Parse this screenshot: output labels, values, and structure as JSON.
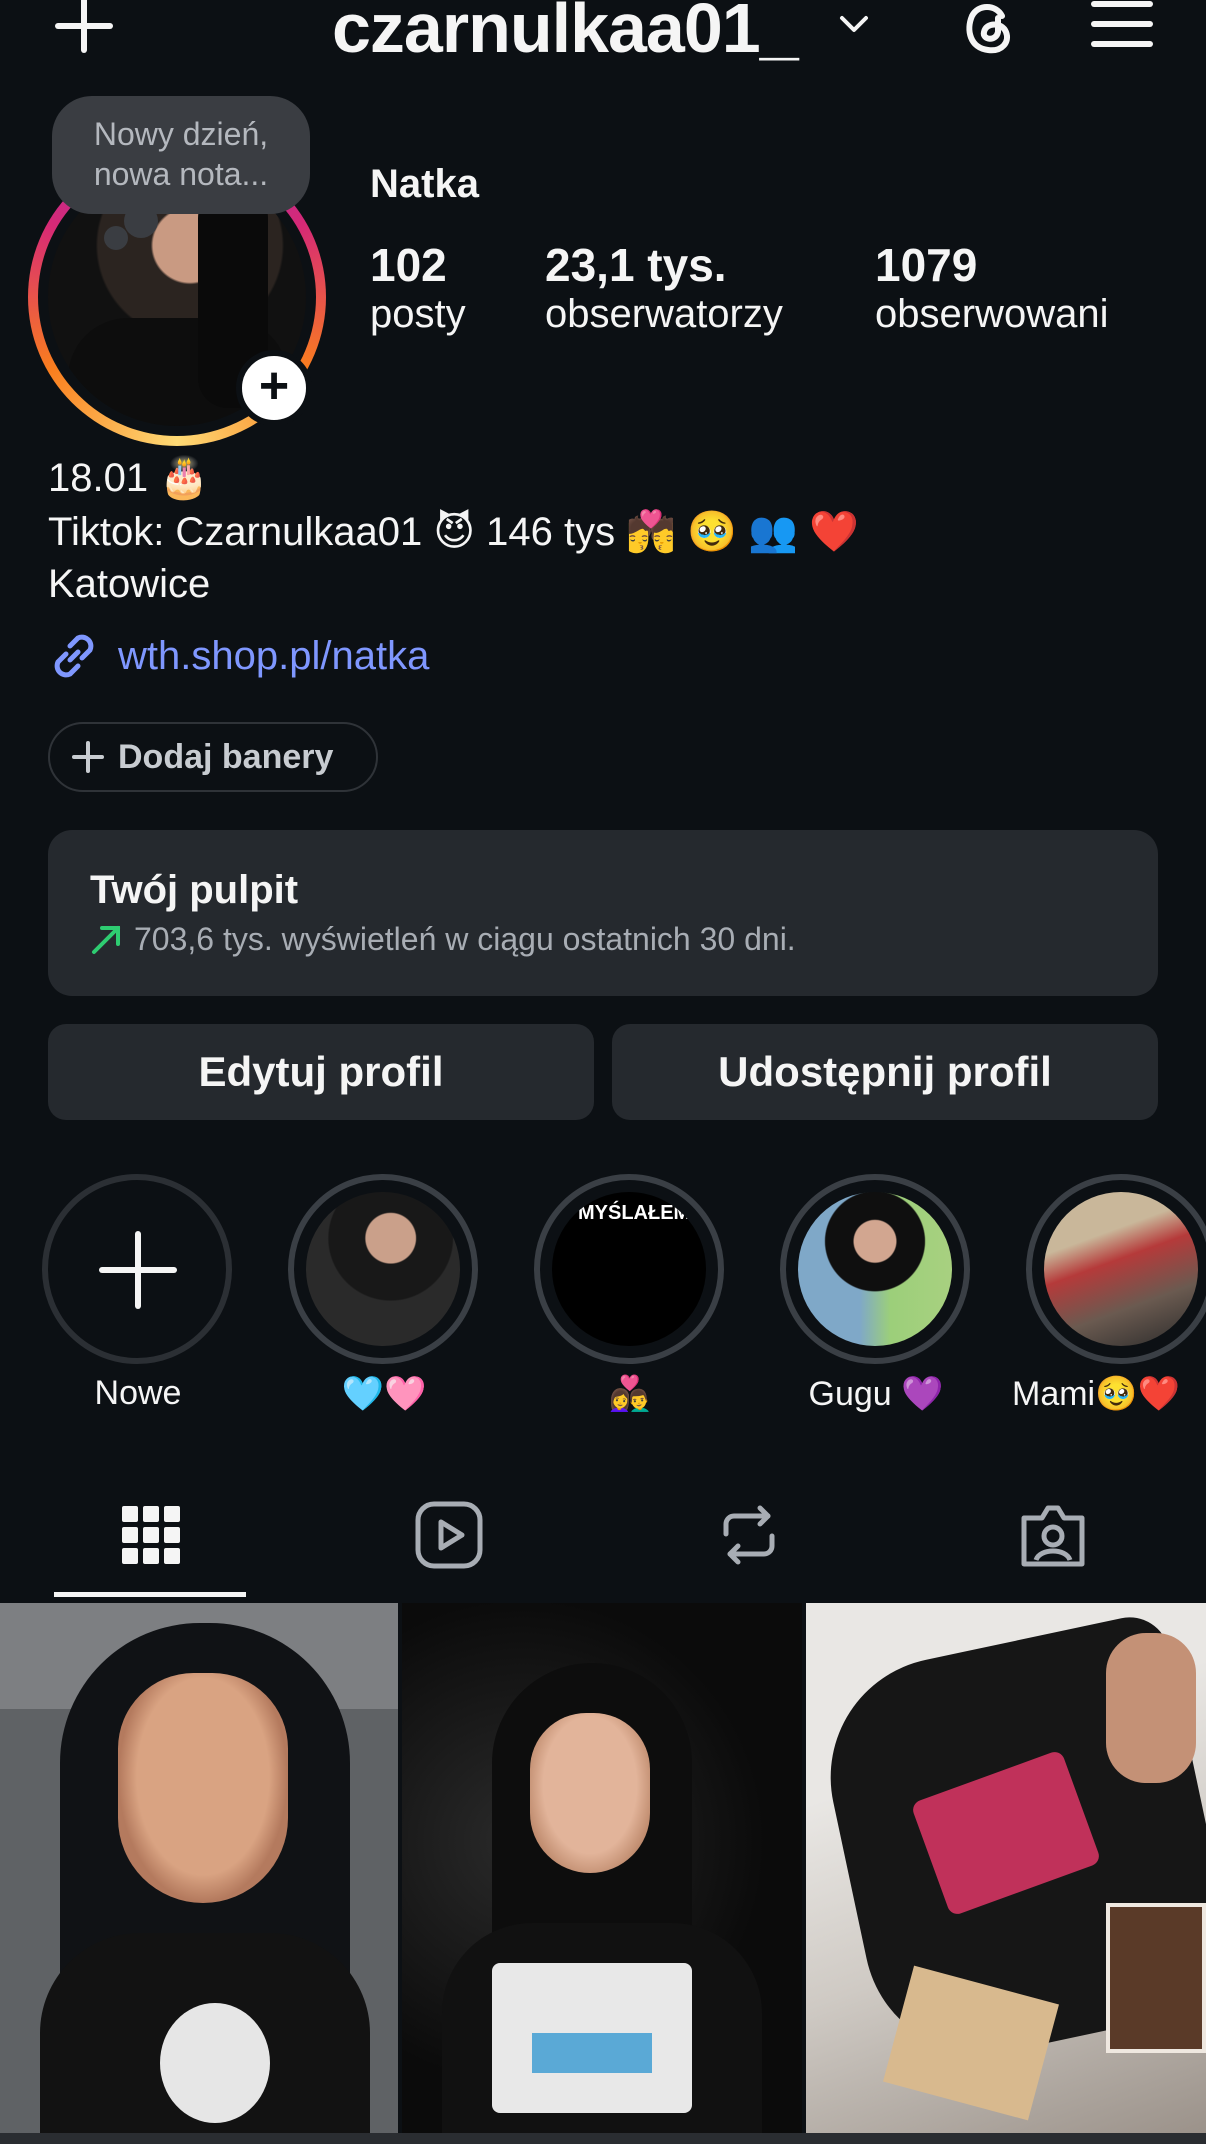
{
  "header": {
    "username": "czarnulkaa01_",
    "icons": [
      "plus-icon",
      "chevron-down-icon",
      "threads-icon",
      "menu-icon"
    ]
  },
  "note": {
    "text_line1": "Nowy dzień,",
    "text_line2": "nowa nota..."
  },
  "profile": {
    "name": "Natka",
    "stats": [
      {
        "value": "102",
        "label": "posty"
      },
      {
        "value": "23,1 tys.",
        "label": "obserwatorzy"
      },
      {
        "value": "1079",
        "label": "obserwowani"
      }
    ],
    "bio": {
      "line1": "18.01 🎂",
      "line2": "Tiktok: Czarnulkaa01 😈 146 tys 💏 🥹 👥 ❤️",
      "line3": "Katowice"
    },
    "link": "wth.shop.pl/natka"
  },
  "banners_button": {
    "label": "Dodaj banery"
  },
  "dashboard": {
    "title": "Twój pulpit",
    "subtitle": "703,6 tys. wyświetleń w ciągu ostatnich 30 dni.",
    "accent": "#2ecc71"
  },
  "buttons": {
    "edit": "Edytuj profil",
    "share": "Udostępnij profil"
  },
  "highlights": [
    {
      "label": "Nowe"
    },
    {
      "label": "🩵🩷"
    },
    {
      "label": "👩‍❤️‍👨",
      "cover_text": "MYŚLAŁEM O LA"
    },
    {
      "label": "Gugu 💜"
    },
    {
      "label": "Mami🥹❤️"
    }
  ],
  "tabs": [
    "grid-icon",
    "reels-icon",
    "reposts-icon",
    "tagged-icon"
  ],
  "colors": {
    "background": "#0c1014",
    "card": "#25292e",
    "link": "#7f97ff"
  }
}
